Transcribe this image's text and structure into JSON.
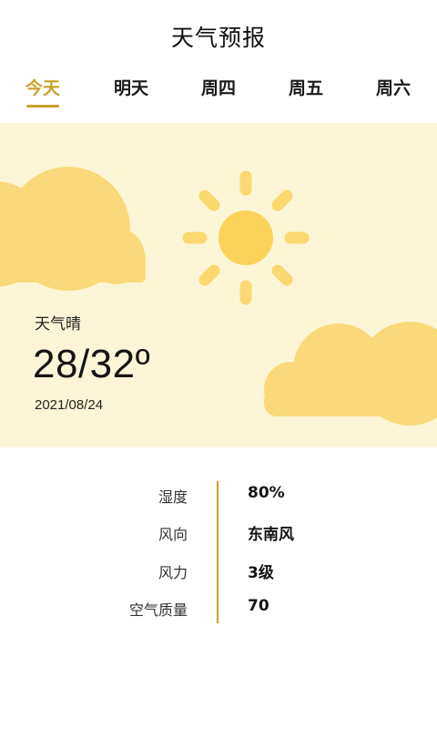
{
  "header": {
    "title": "天气预报"
  },
  "tabs": [
    {
      "label": "今天",
      "active": true
    },
    {
      "label": "明天",
      "active": false
    },
    {
      "label": "周四",
      "active": false
    },
    {
      "label": "周五",
      "active": false
    },
    {
      "label": "周六",
      "active": false
    }
  ],
  "weather": {
    "condition": "天气晴",
    "temperature": "28/32º",
    "date": "2021/08/24",
    "icons": [
      "sun-icon",
      "cloud-icon",
      "cloud-icon"
    ]
  },
  "details": [
    {
      "label": "湿度",
      "value": "80%"
    },
    {
      "label": "风向",
      "value": "东南风"
    },
    {
      "label": "风力",
      "value": "3级"
    },
    {
      "label": "空气质量",
      "value": "70"
    }
  ],
  "colors": {
    "accent": "#c9a227",
    "card_background": "#fdf6d6",
    "sun": "#fbd65a",
    "cloud": "#fbd97a"
  }
}
